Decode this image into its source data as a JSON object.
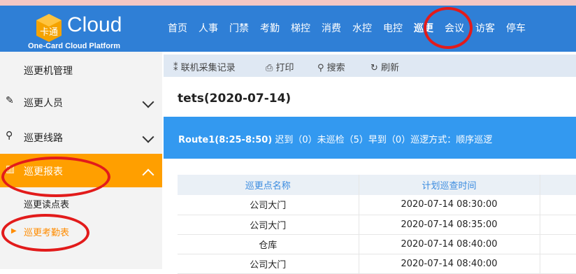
{
  "header": {
    "logo_text": "Cloud",
    "logo_subtitle": "One-Card Cloud Platform",
    "logo_glyph": "卡通",
    "nav": [
      "首页",
      "人事",
      "门禁",
      "考勤",
      "梯控",
      "消费",
      "水控",
      "电控",
      "巡更",
      "会议",
      "访客",
      "停车"
    ],
    "active_nav": "巡更"
  },
  "sidebar": {
    "items": [
      {
        "label": "巡更机管理"
      },
      {
        "label": "巡更人员"
      },
      {
        "label": "巡更线路"
      },
      {
        "label": "巡更报表"
      }
    ],
    "sub_items": [
      {
        "label": "巡更读点表"
      },
      {
        "label": "巡更考勤表"
      }
    ]
  },
  "toolbar": {
    "record": "联机采集记录",
    "print": "打印",
    "search": "搜索",
    "refresh": "刷新"
  },
  "report": {
    "title": "tets(2020-07-14)",
    "route": "Route1(8:25-8:50)",
    "summary": "迟到（0）未巡检（5）早到（0）巡逻方式：顺序巡逻"
  },
  "table": {
    "headers": [
      "巡更点名称",
      "计划巡查时间",
      ""
    ],
    "rows": [
      [
        "公司大门",
        "2020-07-14 08:30:00",
        ""
      ],
      [
        "公司大门",
        "2020-07-14 08:35:00",
        ""
      ],
      [
        "仓库",
        "2020-07-14 08:40:00",
        ""
      ],
      [
        "公司大门",
        "2020-07-14 08:40:00",
        ""
      ]
    ]
  },
  "colors": {
    "header_bg": "#2f7fd6",
    "active_menu": "#ff9f00",
    "banner": "#3399f0",
    "annotation": "#e21b1b"
  }
}
